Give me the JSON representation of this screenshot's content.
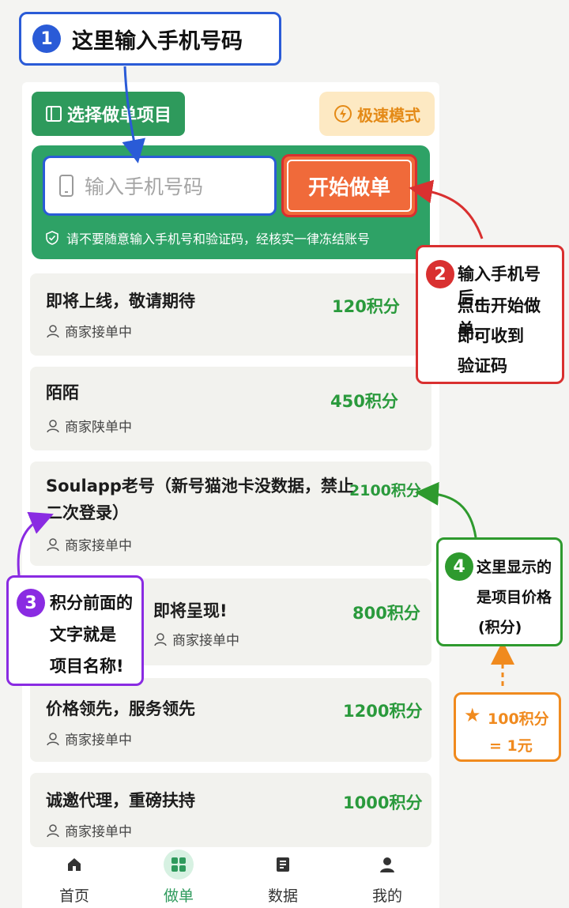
{
  "annotations": {
    "a1": {
      "num": "1",
      "text": "这里输入手机号码"
    },
    "a2": {
      "num": "2",
      "lines": [
        "输入手机号后,",
        "点击开始做单,",
        "即可收到",
        "验证码"
      ]
    },
    "a3": {
      "num": "3",
      "lines": [
        "积分前面的",
        "文字就是",
        "项目名称!"
      ]
    },
    "a4": {
      "num": "4",
      "lines": [
        "这里显示的",
        "是项目价格",
        "(积分)"
      ]
    },
    "a5": {
      "lines": [
        "100积分",
        "= 1元"
      ]
    }
  },
  "toolbar": {
    "select_label": "选择做单项目",
    "speed_label": "极速模式"
  },
  "phone_form": {
    "placeholder": "输入手机号码",
    "start_label": "开始做单",
    "warning": "请不要随意输入手机号和验证码，经核实一律冻结账号"
  },
  "projects": [
    {
      "title": "即将上线，敬请期待",
      "status": "商家接单中",
      "price": "120积分"
    },
    {
      "title": "陌陌",
      "status": "商家陕单中",
      "price": "450积分"
    },
    {
      "title_lines": [
        "Soulapp老号（新号猫池卡没数据，禁止",
        "二次登录）"
      ],
      "status": "商家接单中",
      "price": "2100积分"
    },
    {
      "title": "即将呈现!",
      "status": "商家接单中",
      "price": "800积分"
    },
    {
      "title": "价格领先，服务领先",
      "status": "商家接单中",
      "price": "1200积分"
    },
    {
      "title": "诚邀代理，重磅扶持",
      "status": "商家接单中",
      "price": "1000积分"
    }
  ],
  "nav": {
    "items": [
      {
        "label": "首页",
        "icon": "home-icon"
      },
      {
        "label": "做单",
        "icon": "grid-icon"
      },
      {
        "label": "数据",
        "icon": "document-icon"
      },
      {
        "label": "我的",
        "icon": "user-icon"
      }
    ],
    "active_index": 1
  },
  "colors": {
    "accent_green": "#2e9a5c",
    "price_green": "#2a9a3c",
    "start_orange": "#f06a3a",
    "annotation_blue": "#2a5bd7",
    "annotation_red": "#d93030",
    "annotation_purple": "#8a2be2",
    "annotation_green": "#2e9a2e",
    "annotation_orange": "#f08a1e"
  }
}
